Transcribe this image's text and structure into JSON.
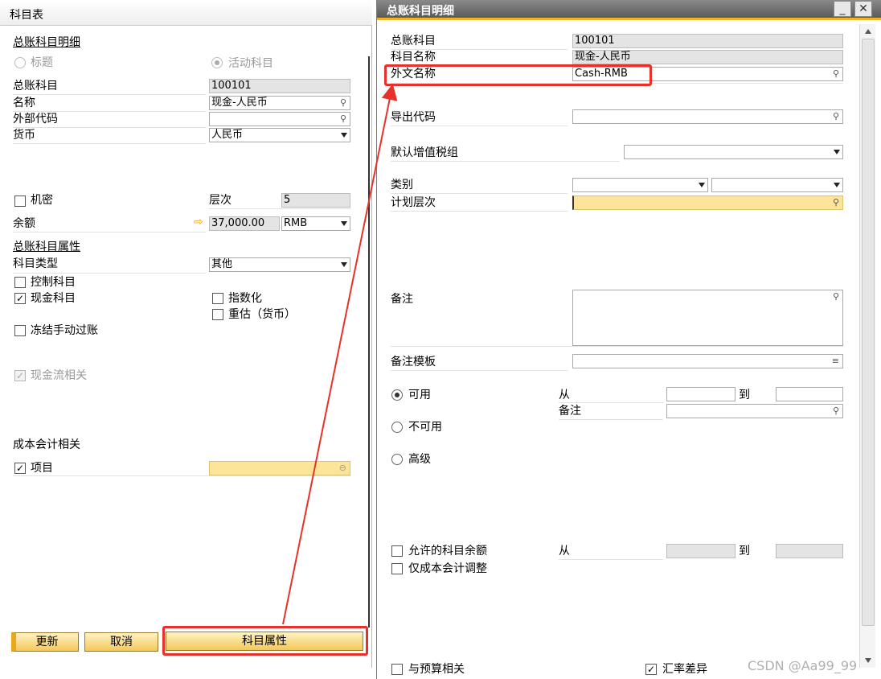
{
  "left": {
    "title": "科目表",
    "section_detail": "总账科目明细",
    "radio_title": "标题",
    "radio_active": "活动科目",
    "account_label": "总账科目",
    "account_value": "100101",
    "name_label": "名称",
    "name_value": "现金-人民币",
    "external_code_label": "外部代码",
    "external_code_value": "",
    "currency_label": "货币",
    "currency_value": "人民币",
    "confidential_label": "机密",
    "level_label": "层次",
    "level_value": "5",
    "balance_label": "余额",
    "balance_value": "37,000.00",
    "balance_currency": "RMB",
    "section_properties": "总账科目属性",
    "account_type_label": "科目类型",
    "account_type_value": "其他",
    "control_account": "控制科目",
    "cash_account": "现金科目",
    "cash_account_checked": true,
    "indexed": "指数化",
    "revaluation": "重估（货币）",
    "freeze_manual": "冻结手动过账",
    "cashflow_relevant": "现金流相关",
    "cashflow_checked": true,
    "cost_accounting": "成本会计相关",
    "project_label": "项目",
    "project_checked": true,
    "btn_update": "更新",
    "btn_cancel": "取消",
    "btn_properties": "科目属性"
  },
  "right": {
    "title": "总账科目明细",
    "minimize_glyph": "_",
    "close_glyph": "✕",
    "gl_account_label": "总账科目",
    "gl_account_value": "100101",
    "account_name_label": "科目名称",
    "account_name_value": "现金-人民币",
    "foreign_name_label": "外文名称",
    "foreign_name_value": "Cash-RMB",
    "export_code_label": "导出代码",
    "default_vat_label": "默认增值税组",
    "category_label": "类别",
    "planning_level_label": "计划层次",
    "remarks_label": "备注",
    "remarks_template_label": "备注模板",
    "active_label": "可用",
    "inactive_label": "不可用",
    "advanced_label": "高级",
    "from_label": "从",
    "to_label": "到",
    "remarks_small_label": "备注",
    "allow_balance_label": "允许的科目余额",
    "allow_from_label": "从",
    "allow_to_label": "到",
    "cost_adjust_only_label": "仅成本会计调整",
    "budget_relevant_label": "与预算相关",
    "exchange_diff_label": "汇率差异",
    "exchange_diff_checked": true
  },
  "watermark": "CSDN @Aa99_99",
  "colors": {
    "annotation_red": "#e8312a",
    "button_gold": "#f3c85a",
    "titlebar_accent": "#f0b422",
    "required_yellow": "#fce59a"
  },
  "icons": {
    "field_link": "link-icon",
    "balance_arrow": "right-arrow-icon",
    "dropdown": "chevron-down-icon"
  }
}
